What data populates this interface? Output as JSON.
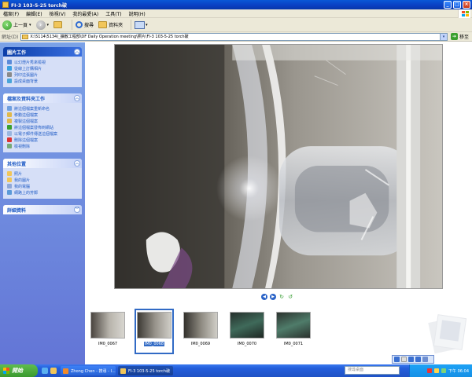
{
  "window": {
    "title": "FI-3 103-5-25 torch破"
  },
  "menu": [
    "檔案(F)",
    "編輯(E)",
    "檢視(V)",
    "我的最愛(A)",
    "工具(T)",
    "說明(H)"
  ],
  "toolbar": {
    "back_label": "上一頁",
    "search_label": "搜尋",
    "folders_label": "資料夾"
  },
  "address": {
    "label": "網址(D)",
    "path": "X:\\5114\\5134)_擴散工程部\\DF Daily Operation meeting\\照片\\FI-3 103-5-25 torch破",
    "go_label": "移至"
  },
  "sidebar": {
    "picture_tasks": {
      "title": "圖片工作",
      "items": [
        "以幻燈片秀來檢視",
        "從線上訂購相片",
        "列印這張圖片",
        "設成桌面背景"
      ]
    },
    "file_tasks": {
      "title": "檔案及資料夾工作",
      "items": [
        "將這個檔案重新命名",
        "移動這個檔案",
        "複製這個檔案",
        "將這個檔案發佈到網站",
        "以電子郵件傳送這個檔案",
        "刪除這個檔案",
        "檢視刪除"
      ]
    },
    "other_places": {
      "title": "其他位置",
      "items": [
        "照片",
        "我的圖片",
        "我的電腦",
        "網路上的芳鄰"
      ]
    },
    "details": {
      "title": "詳細資料"
    }
  },
  "filmstrip": {
    "thumbnails": [
      {
        "caption": "IM0_0067",
        "selected": false
      },
      {
        "caption": "IM0_0068",
        "selected": true
      },
      {
        "caption": "IM0_0069",
        "selected": false
      },
      {
        "caption": "IM0_0070",
        "selected": false
      },
      {
        "caption": "IM0_0071",
        "selected": false
      }
    ]
  },
  "taskbar": {
    "start_label": "開始",
    "buttons": [
      {
        "label": "Zhong Chen - 搜尋 - I...",
        "active": false
      },
      {
        "label": "FI-3 103-5-25 torch破",
        "active": true
      }
    ],
    "search_placeholder": "搜尋桌面",
    "clock": "下午 06:04"
  },
  "colors": {
    "title_blue": "#0a58d6",
    "sidebar_blue": "#7ba2e7",
    "task_link": "#215dc6",
    "start_green": "#3a9a2e"
  }
}
